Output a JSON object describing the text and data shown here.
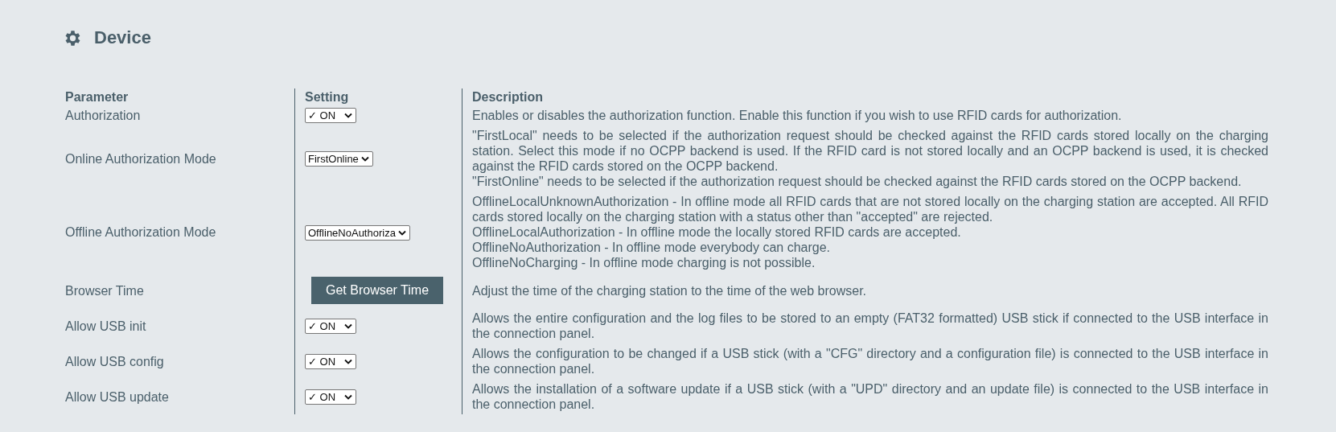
{
  "page": {
    "title": "Device"
  },
  "table": {
    "columns": [
      "Parameter",
      "Setting",
      "Description"
    ],
    "rows": [
      {
        "parameter": "Authorization",
        "setting": {
          "kind": "select",
          "value": "✓ ON"
        },
        "description": [
          "Enables or disables the authorization function. Enable this function if you wish to use RFID cards for authorization."
        ]
      },
      {
        "parameter": "Online Authorization Mode",
        "setting": {
          "kind": "select",
          "value": "FirstOnline"
        },
        "description": [
          "\"FirstLocal\" needs to be selected if the authorization request should be checked against the RFID cards stored locally on the charging station. Select this mode if no OCPP backend is used. If the RFID card is not stored locally and an OCPP backend is used, it is checked against the RFID cards stored on the OCPP backend.",
          "\"FirstOnline\" needs to be selected if the authorization request should be checked against the RFID cards stored on the OCPP backend."
        ]
      },
      {
        "parameter": "Offline Authorization Mode",
        "setting": {
          "kind": "select",
          "value": "OfflineNoAuthoriza"
        },
        "description": [
          "OfflineLocalUnknownAuthorization - In offline mode all RFID cards that are not stored locally on the charging station are accepted. All RFID cards stored locally on the charging station with a status other than \"accepted\" are rejected.",
          "OfflineLocalAuthorization - In offline mode the locally stored RFID cards are accepted.",
          "OfflineNoAuthorization - In offline mode everybody can charge.",
          "OfflineNoCharging - In offline mode charging is not possible."
        ]
      },
      {
        "parameter": "Browser Time",
        "setting": {
          "kind": "button",
          "label": "Get Browser Time"
        },
        "description": [
          "Adjust the time of the charging station to the time of the web browser."
        ]
      },
      {
        "parameter": "Allow USB init",
        "setting": {
          "kind": "select",
          "value": "✓ ON"
        },
        "description": [
          "Allows the entire configuration and the log files to be stored to an empty (FAT32 formatted) USB stick if connected to the USB interface in the connection panel."
        ]
      },
      {
        "parameter": "Allow USB config",
        "setting": {
          "kind": "select",
          "value": "✓ ON"
        },
        "description": [
          "Allows the configuration to be changed if a USB stick (with a \"CFG\" directory and a configuration file) is connected to the USB interface in the connection panel."
        ]
      },
      {
        "parameter": "Allow USB update",
        "setting": {
          "kind": "select",
          "value": "✓ ON"
        },
        "description": [
          "Allows the installation of a software update if a USB stick (with a \"UPD\" directory and an update file) is connected to the USB interface in the connection panel."
        ]
      }
    ]
  }
}
